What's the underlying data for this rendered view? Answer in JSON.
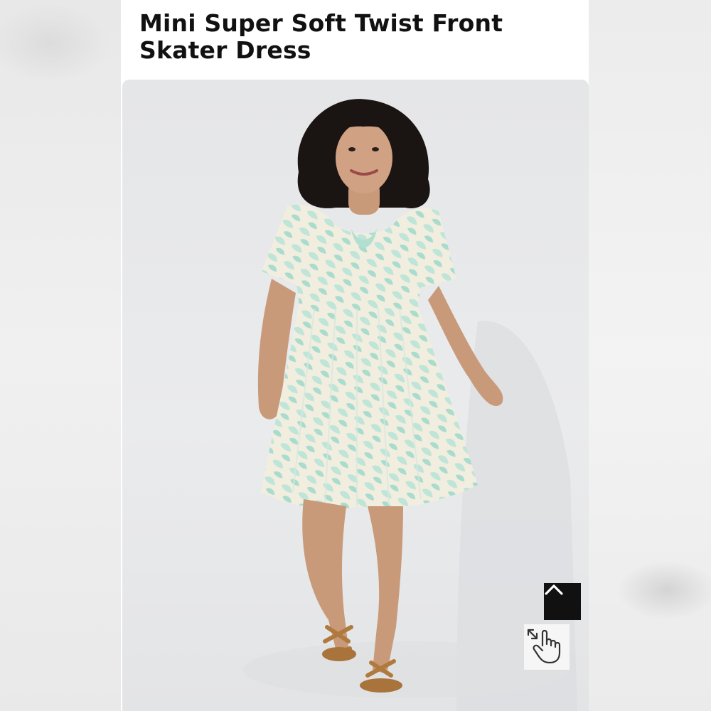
{
  "product": {
    "title_line1": "Mini Super Soft Twist Front",
    "title_line2": "Skater Dress"
  },
  "image": {
    "alt": "Model wearing mint printed skater dress"
  },
  "controls": {
    "scroll_top_icon": "chevron-up-icon",
    "zoom_icon": "pinch-zoom-hand-icon"
  },
  "colors": {
    "title": "#111111",
    "scroll_top_bg": "#111111",
    "dress_mint": "#bfe5d8",
    "dress_cream": "#f1eee0"
  }
}
